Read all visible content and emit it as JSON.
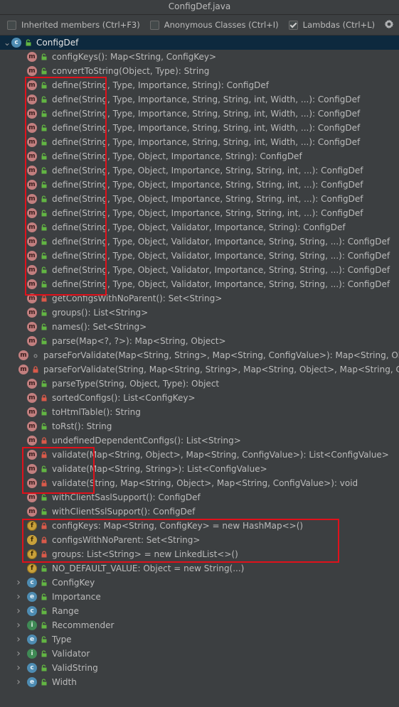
{
  "window_title": "ConfigDef.java",
  "toolbar": {
    "inherited_label": "Inherited members (Ctrl+F3)",
    "inherited_checked": false,
    "anonymous_label": "Anonymous Classes (Ctrl+I)",
    "anonymous_checked": false,
    "lambdas_label": "Lambdas (Ctrl+L)",
    "lambdas_checked": true
  },
  "colors": {
    "method_icon": "#c27f7f",
    "field_icon": "#c8a03a",
    "class_icon": "#4e8cb2",
    "public_green": "#62b543",
    "private_red": "#d95a4a",
    "highlight_red": "#e0111b",
    "selection": "#0d293e"
  },
  "tree": [
    {
      "label": "ConfigDef",
      "icon": "class",
      "vis": "public",
      "level": 0,
      "arrow": "expanded",
      "selected": true
    },
    {
      "label": "configKeys(): Map<String, ConfigKey>",
      "icon": "method",
      "vis": "public",
      "level": 1
    },
    {
      "label": "convertToString(Object, Type): String",
      "icon": "method",
      "vis": "public",
      "level": 1
    },
    {
      "label": "define(String, Type, Importance, String): ConfigDef",
      "icon": "method",
      "vis": "public",
      "level": 1
    },
    {
      "label": "define(String, Type, Importance, String, String, int, Width, ...): ConfigDef",
      "icon": "method",
      "vis": "public",
      "level": 1
    },
    {
      "label": "define(String, Type, Importance, String, String, int, Width, ...): ConfigDef",
      "icon": "method",
      "vis": "public",
      "level": 1
    },
    {
      "label": "define(String, Type, Importance, String, String, int, Width, ...): ConfigDef",
      "icon": "method",
      "vis": "public",
      "level": 1
    },
    {
      "label": "define(String, Type, Importance, String, String, int, Width, ...): ConfigDef",
      "icon": "method",
      "vis": "public",
      "level": 1
    },
    {
      "label": "define(String, Type, Object, Importance, String): ConfigDef",
      "icon": "method",
      "vis": "public",
      "level": 1
    },
    {
      "label": "define(String, Type, Object, Importance, String, String, int, ...): ConfigDef",
      "icon": "method",
      "vis": "public",
      "level": 1
    },
    {
      "label": "define(String, Type, Object, Importance, String, String, int, ...): ConfigDef",
      "icon": "method",
      "vis": "public",
      "level": 1
    },
    {
      "label": "define(String, Type, Object, Importance, String, String, int, ...): ConfigDef",
      "icon": "method",
      "vis": "public",
      "level": 1
    },
    {
      "label": "define(String, Type, Object, Importance, String, String, int, ...): ConfigDef",
      "icon": "method",
      "vis": "public",
      "level": 1
    },
    {
      "label": "define(String, Type, Object, Validator, Importance, String): ConfigDef",
      "icon": "method",
      "vis": "public",
      "level": 1
    },
    {
      "label": "define(String, Type, Object, Validator, Importance, String, String, ...): ConfigDef",
      "icon": "method",
      "vis": "public",
      "level": 1
    },
    {
      "label": "define(String, Type, Object, Validator, Importance, String, String, ...): ConfigDef",
      "icon": "method",
      "vis": "public",
      "level": 1
    },
    {
      "label": "define(String, Type, Object, Validator, Importance, String, String, ...): ConfigDef",
      "icon": "method",
      "vis": "public",
      "level": 1
    },
    {
      "label": "define(String, Type, Object, Validator, Importance, String, String, ...): ConfigDef",
      "icon": "method",
      "vis": "public",
      "level": 1
    },
    {
      "label": "getConfigsWithNoParent(): Set<String>",
      "icon": "method",
      "vis": "private",
      "level": 1
    },
    {
      "label": "groups(): List<String>",
      "icon": "method",
      "vis": "public",
      "level": 1
    },
    {
      "label": "names(): Set<String>",
      "icon": "method",
      "vis": "public",
      "level": 1
    },
    {
      "label": "parse(Map<?, ?>): Map<String, Object>",
      "icon": "method",
      "vis": "public",
      "level": 1
    },
    {
      "label": "parseForValidate(Map<String, String>, Map<String, ConfigValue>): Map<String, Ob",
      "icon": "method",
      "vis": "package",
      "level": 1
    },
    {
      "label": "parseForValidate(String, Map<String, String>, Map<String, Object>, Map<String, C",
      "icon": "method",
      "vis": "private",
      "level": 1
    },
    {
      "label": "parseType(String, Object, Type): Object",
      "icon": "method",
      "vis": "public",
      "level": 1
    },
    {
      "label": "sortedConfigs(): List<ConfigKey>",
      "icon": "method",
      "vis": "private",
      "level": 1
    },
    {
      "label": "toHtmlTable(): String",
      "icon": "method",
      "vis": "public",
      "level": 1
    },
    {
      "label": "toRst(): String",
      "icon": "method",
      "vis": "public",
      "level": 1
    },
    {
      "label": "undefinedDependentConfigs(): List<String>",
      "icon": "method",
      "vis": "private",
      "level": 1
    },
    {
      "label": "validate(Map<String, Object>, Map<String, ConfigValue>): List<ConfigValue>",
      "icon": "method",
      "vis": "private",
      "level": 1
    },
    {
      "label": "validate(Map<String, String>): List<ConfigValue>",
      "icon": "method",
      "vis": "public",
      "level": 1
    },
    {
      "label": "validate(String, Map<String, Object>, Map<String, ConfigValue>): void",
      "icon": "method",
      "vis": "private",
      "level": 1
    },
    {
      "label": "withClientSaslSupport(): ConfigDef",
      "icon": "method",
      "vis": "public",
      "level": 1
    },
    {
      "label": "withClientSslSupport(): ConfigDef",
      "icon": "method",
      "vis": "public",
      "level": 1
    },
    {
      "label": "configKeys: Map<String, ConfigKey> = new HashMap<>()",
      "icon": "field-final",
      "vis": "private",
      "level": 1
    },
    {
      "label": "configsWithNoParent: Set<String>",
      "icon": "field",
      "vis": "private",
      "level": 1
    },
    {
      "label": "groups: List<String> = new LinkedList<>()",
      "icon": "field-final",
      "vis": "private",
      "level": 1
    },
    {
      "label": "NO_DEFAULT_VALUE: Object = new String(...)",
      "icon": "field-final",
      "vis": "public",
      "level": 1
    },
    {
      "label": "ConfigKey",
      "icon": "class",
      "vis": "public",
      "level": 1,
      "arrow": "collapsed"
    },
    {
      "label": "Importance",
      "icon": "enum",
      "vis": "public",
      "level": 1,
      "arrow": "collapsed"
    },
    {
      "label": "Range",
      "icon": "class",
      "vis": "public",
      "level": 1,
      "arrow": "collapsed"
    },
    {
      "label": "Recommender",
      "icon": "interface",
      "vis": "public",
      "level": 1,
      "arrow": "collapsed"
    },
    {
      "label": "Type",
      "icon": "enum",
      "vis": "public",
      "level": 1,
      "arrow": "collapsed"
    },
    {
      "label": "Validator",
      "icon": "interface",
      "vis": "public",
      "level": 1,
      "arrow": "collapsed"
    },
    {
      "label": "ValidString",
      "icon": "class",
      "vis": "public",
      "level": 1,
      "arrow": "collapsed"
    },
    {
      "label": "Width",
      "icon": "enum",
      "vis": "public",
      "level": 1,
      "arrow": "collapsed"
    }
  ]
}
